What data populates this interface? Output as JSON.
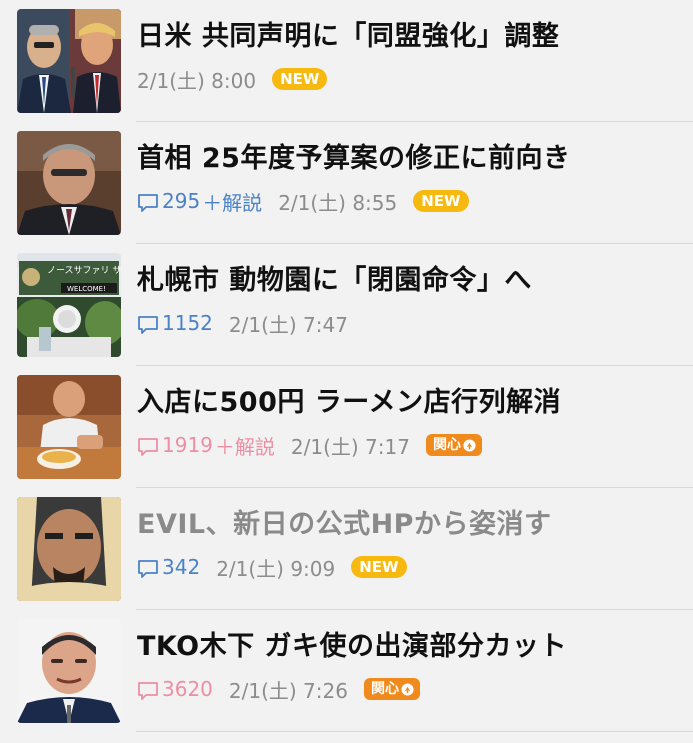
{
  "articles": [
    {
      "title": "日米 共同声明に「同盟強化」調整",
      "timestamp": "2/1(土) 8:00",
      "badge": "NEW",
      "read": false,
      "thumbnail": "two-politicians-photo"
    },
    {
      "title": "首相 25年度予算案の修正に前向き",
      "comments": "295",
      "comment_extra": "＋解説",
      "comment_color": "#4a82c8",
      "timestamp": "2/1(土) 8:55",
      "badge": "NEW",
      "read": false,
      "thumbnail": "prime-minister-photo"
    },
    {
      "title": "札幌市 動物園に「閉園命令」へ",
      "comments": "1152",
      "comment_color": "#4a82c8",
      "timestamp": "2/1(土) 7:47",
      "read": false,
      "thumbnail": "zoo-entrance-photo",
      "thumbnail_sign": "ノースサファリ サッポロ",
      "thumbnail_sign_sub": "WELCOME!"
    },
    {
      "title": "入店に500円 ラーメン店行列解消",
      "comments": "1919",
      "comment_extra": "＋解説",
      "comment_color": "#ec8fa3",
      "timestamp": "2/1(土) 7:17",
      "badge": "関心",
      "read": false,
      "thumbnail": "ramen-chef-photo"
    },
    {
      "title": "EVIL、新日の公式HPから姿消す",
      "comments": "342",
      "comment_color": "#4a82c8",
      "timestamp": "2/1(土) 9:09",
      "badge": "NEW",
      "read": true,
      "thumbnail": "wrestler-photo"
    },
    {
      "title": "TKO木下 ガキ使の出演部分カット",
      "comments": "3620",
      "comment_color": "#ec8fa3",
      "timestamp": "2/1(土) 7:26",
      "badge": "関心",
      "read": false,
      "thumbnail": "comedian-photo"
    }
  ],
  "colors": {
    "background": "#f2f2f2",
    "new_badge": "#f7b80f",
    "attention_badge": "#f08a1c",
    "comment_blue": "#4a82c8",
    "comment_pink": "#ec8fa3"
  }
}
